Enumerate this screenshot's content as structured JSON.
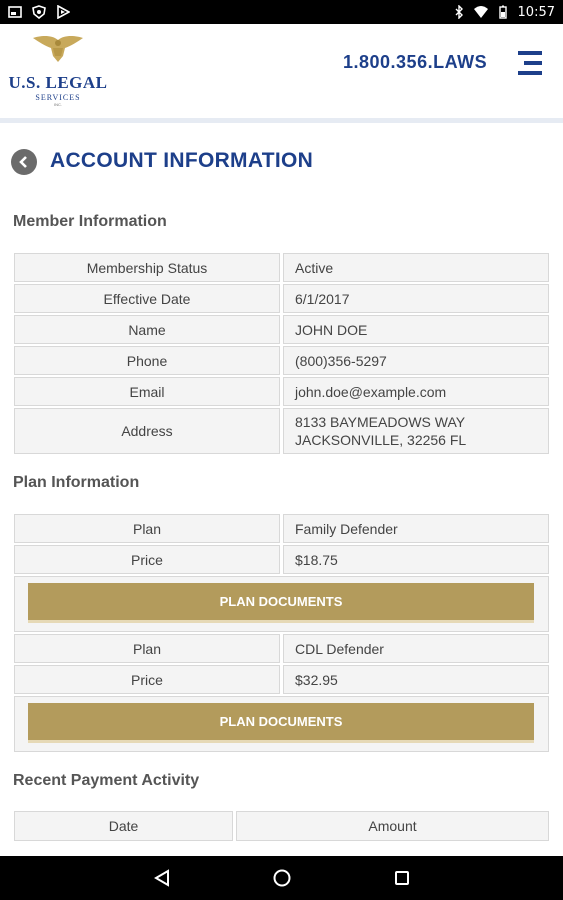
{
  "status_bar": {
    "time": "10:57"
  },
  "header": {
    "logo": {
      "brand": "U.S. LEGAL",
      "sub": "SERVICES",
      "tiny": "INC."
    },
    "phone": "1.800.356.LAWS",
    "menu_icon": "menu-icon"
  },
  "page": {
    "title": "ACCOUNT INFORMATION"
  },
  "member": {
    "heading": "Member Information",
    "rows": [
      {
        "label": "Membership Status",
        "value": "Active"
      },
      {
        "label": "Effective Date",
        "value": "6/1/2017"
      },
      {
        "label": "Name",
        "value": "JOHN DOE"
      },
      {
        "label": "Phone",
        "value": "(800)356-5297"
      },
      {
        "label": "Email",
        "value": "john.doe@example.com"
      },
      {
        "label": "Address",
        "value_line1": "8133 BAYMEADOWS WAY",
        "value_line2": "JACKSONVILLE, 32256 FL"
      }
    ]
  },
  "plans": {
    "heading": "Plan Information",
    "items": [
      {
        "plan_label": "Plan",
        "plan_value": "Family Defender",
        "price_label": "Price",
        "price_value": "$18.75",
        "button": "PLAN DOCUMENTS"
      },
      {
        "plan_label": "Plan",
        "plan_value": "CDL Defender",
        "price_label": "Price",
        "price_value": "$32.95",
        "button": "PLAN DOCUMENTS"
      }
    ]
  },
  "payments": {
    "heading": "Recent Payment Activity",
    "columns": [
      "Date",
      "Amount"
    ]
  },
  "colors": {
    "primary": "#1d3f8a",
    "gold": "#b39b5c"
  }
}
